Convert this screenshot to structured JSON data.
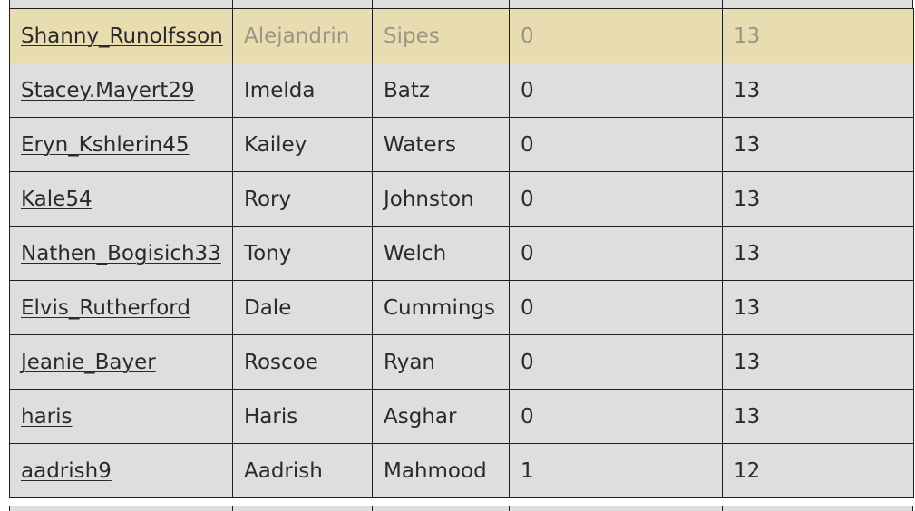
{
  "colors": {
    "row_bg": "#dedede",
    "highlight_row_bg": "#e8dcb1",
    "highlight_text": "#9c9685",
    "border": "#1e1e1e",
    "text": "#2a2a2a"
  },
  "rows": [
    {
      "username": "Shanny_Runolfsson",
      "first_name": "Alejandrin",
      "last_name": "Sipes",
      "col4": "0",
      "col5": "13",
      "highlighted": true
    },
    {
      "username": "Stacey.Mayert29",
      "first_name": "Imelda",
      "last_name": "Batz",
      "col4": "0",
      "col5": "13"
    },
    {
      "username": "Eryn_Kshlerin45",
      "first_name": "Kailey",
      "last_name": "Waters",
      "col4": "0",
      "col5": "13"
    },
    {
      "username": "Kale54",
      "first_name": "Rory",
      "last_name": "Johnston",
      "col4": "0",
      "col5": "13"
    },
    {
      "username": "Nathen_Bogisich33",
      "first_name": "Tony",
      "last_name": "Welch",
      "col4": "0",
      "col5": "13"
    },
    {
      "username": "Elvis_Rutherford",
      "first_name": "Dale",
      "last_name": "Cummings",
      "col4": "0",
      "col5": "13"
    },
    {
      "username": "Jeanie_Bayer",
      "first_name": "Roscoe",
      "last_name": "Ryan",
      "col4": "0",
      "col5": "13"
    },
    {
      "username": "haris",
      "first_name": "Haris",
      "last_name": "Asghar",
      "col4": "0",
      "col5": "13"
    },
    {
      "username": "aadrish9",
      "first_name": "Aadrish",
      "last_name": "Mahmood",
      "col4": "1",
      "col5": "12"
    }
  ]
}
